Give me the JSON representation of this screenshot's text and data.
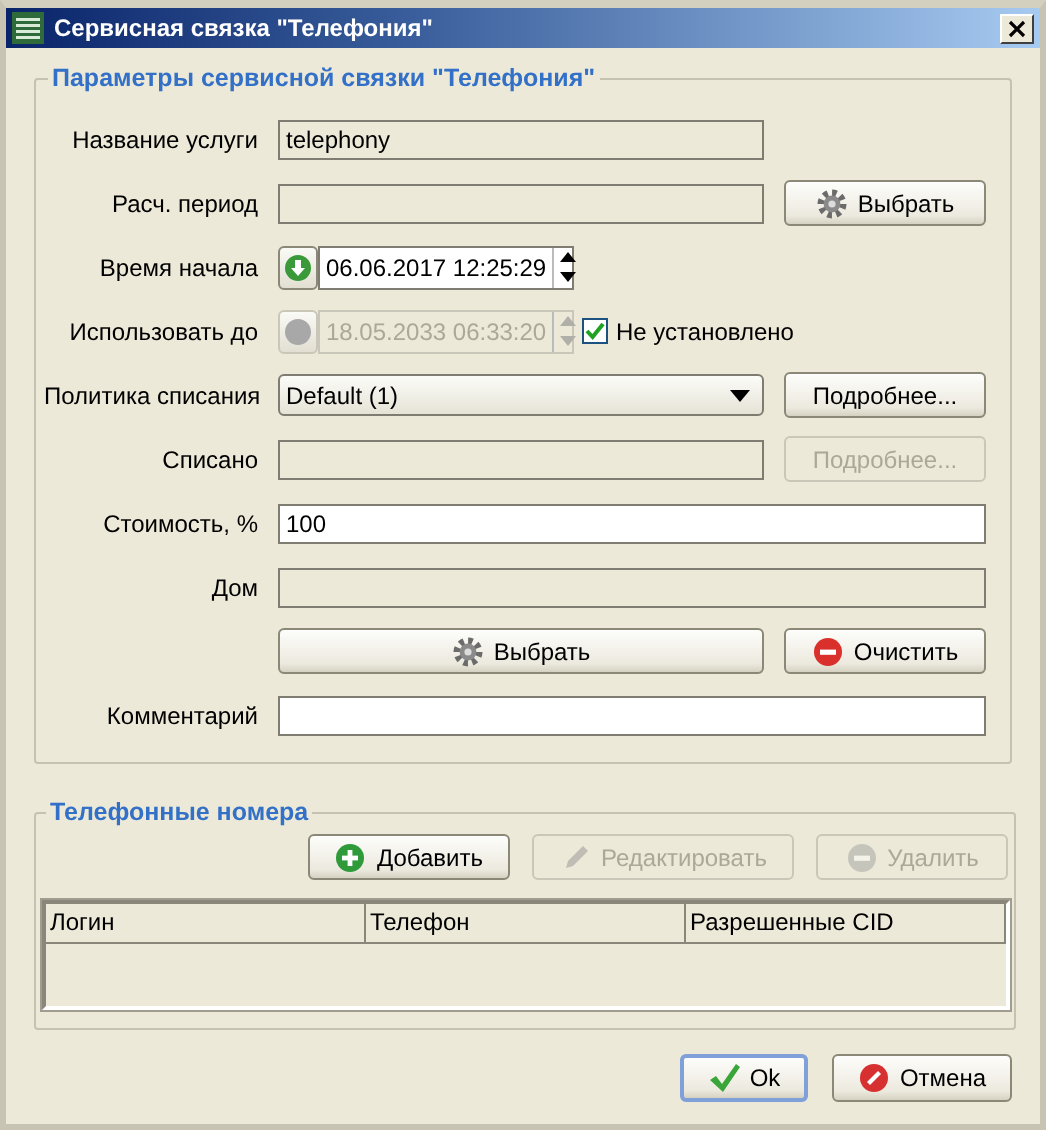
{
  "window": {
    "title": "Сервисная связка \"Телефония\""
  },
  "params": {
    "title": "Параметры сервисной связки \"Телефония\"",
    "rows": [
      {
        "kind": "short-field",
        "label": "Название услуги",
        "value": "telephony",
        "editable": false
      },
      {
        "kind": "field-button",
        "label": "Расч. период",
        "editable": false,
        "button": {
          "label": "Выбрать",
          "kind": "gear",
          "disabled": false
        }
      },
      {
        "kind": "datetime",
        "label": "Время начала",
        "value": "06.06.2017 12:25:29",
        "disabled": false
      },
      {
        "kind": "datetime",
        "label": "Использовать до",
        "value": "18.05.2033 06:33:20",
        "disabled": true,
        "checkbox": {
          "label": "Не установлено",
          "checked": true
        }
      },
      {
        "kind": "combo-button",
        "label": "Политика списания",
        "value": "Default (1)",
        "button": {
          "label": "Подробнее...",
          "disabled": false
        }
      },
      {
        "kind": "field-button",
        "label": "Списано",
        "editable": false,
        "button": {
          "label": "Подробнее...",
          "disabled": true
        }
      },
      {
        "kind": "field",
        "label": "Стоимость, %",
        "value": "100",
        "editable": true
      },
      {
        "kind": "field",
        "label": "Дом",
        "editable": false
      },
      {
        "kind": "buttons",
        "buttons": [
          {
            "label": "Выбрать",
            "kind": "gear",
            "disabled": false
          },
          {
            "label": "Очистить",
            "kind": "clear",
            "disabled": false
          }
        ]
      },
      {
        "kind": "field",
        "label": "Комментарий",
        "editable": true
      }
    ]
  },
  "phones": {
    "title": "Телефонные номера",
    "buttons": [
      {
        "label": "Добавить",
        "kind": "add",
        "disabled": false
      },
      {
        "label": "Редактировать",
        "kind": "pencil",
        "disabled": true
      },
      {
        "label": "Удалить",
        "kind": "remove",
        "disabled": true
      }
    ],
    "columns": [
      "Логин",
      "Телефон",
      "Разрешенные CID"
    ]
  },
  "footer": {
    "buttons": [
      {
        "label": "Ok",
        "kind": "ok",
        "default": true
      },
      {
        "label": "Отмена",
        "kind": "cancel",
        "default": false
      }
    ]
  }
}
